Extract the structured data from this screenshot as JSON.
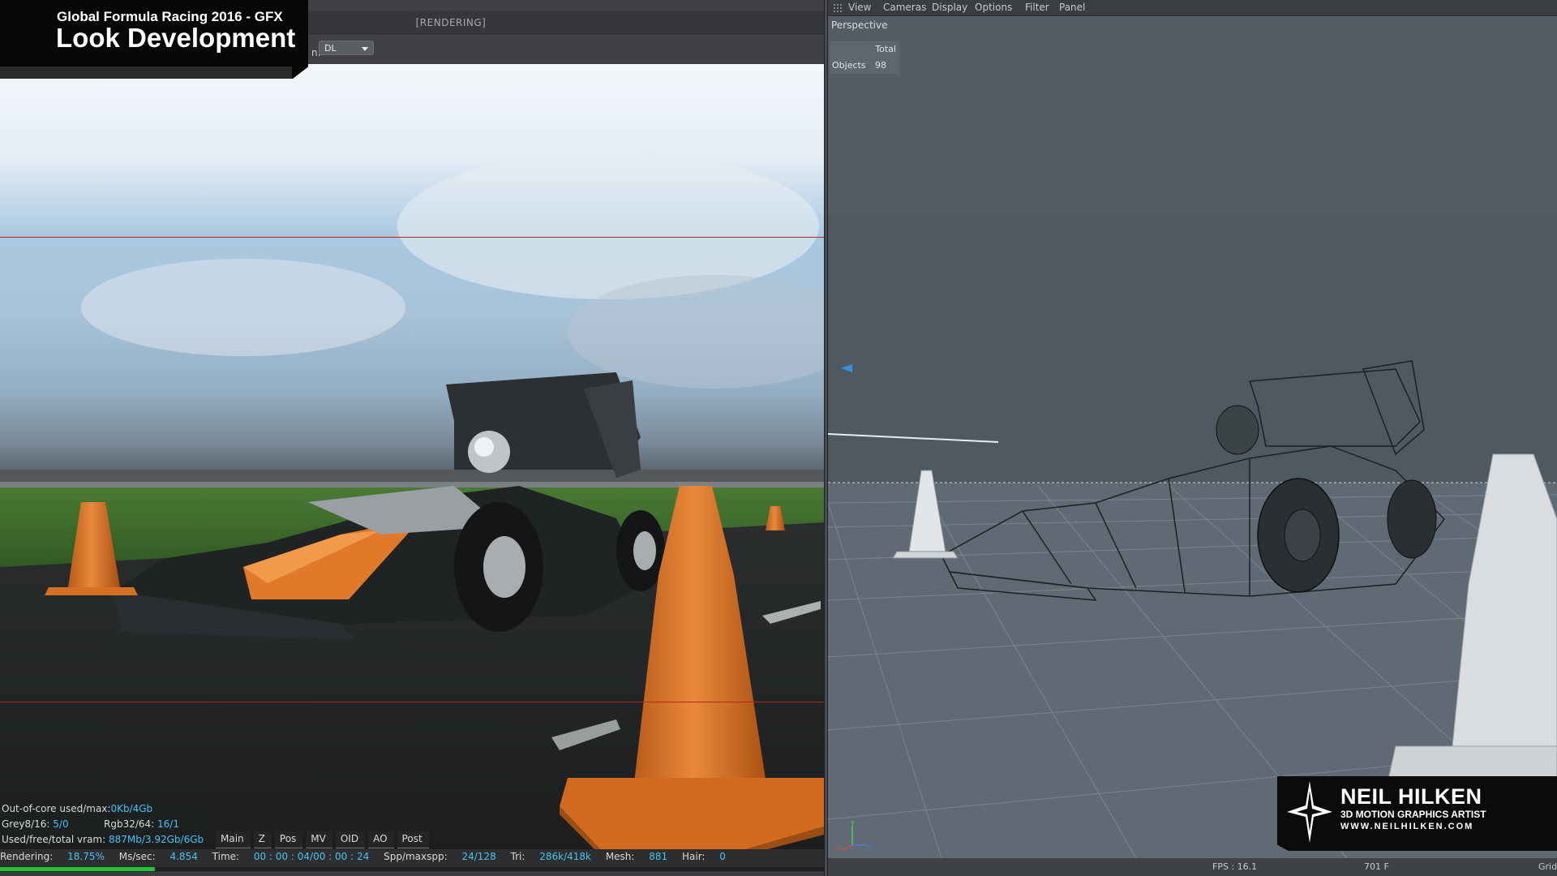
{
  "title_badge": {
    "subtitle": "Global Formula Racing 2016 - GFX",
    "title": "Look Development"
  },
  "render_window": {
    "status": "[RENDERING]",
    "kernel_label_fragment": "n:",
    "kernel_value": "DL",
    "stats": {
      "outofcore_label": "Out-of-core used/max:",
      "outofcore_value": "0Kb/4Gb",
      "grey_label": "Grey8/16: ",
      "grey_value": "5/0",
      "rgb_label": "Rgb32/64: ",
      "rgb_value": "16/1",
      "vram_label": "Used/free/total vram: ",
      "vram_value": "887Mb/3.92Gb/6Gb"
    },
    "passes": [
      "Main",
      "Z",
      "Pos",
      "MV",
      "OID",
      "AO",
      "Post"
    ],
    "status_bar": {
      "rendering_label": "Rendering: ",
      "rendering_value": "18.75%",
      "mssec_label": "Ms/sec: ",
      "mssec_value": "4.854",
      "time_label": "Time: ",
      "time_value": "00 : 00 : 04/00 : 00 : 24",
      "spp_label": "Spp/maxspp: ",
      "spp_value": "24/128",
      "tri_label": "Tri: ",
      "tri_value": "286k/418k",
      "mesh_label": "Mesh: ",
      "mesh_value": "881",
      "hair_label": "Hair: ",
      "hair_value": "0"
    },
    "progress_fraction": 0.1875
  },
  "viewport": {
    "menu": [
      "View",
      "Cameras",
      "Display",
      "Options",
      "Filter",
      "Panel"
    ],
    "camera": "Perspective",
    "stats_header": "Total",
    "stats_label": "Objects",
    "stats_value": "98",
    "fps": "FPS : 16.1",
    "frame": "701 F",
    "grid": "Grid"
  },
  "watermark": {
    "name": "NEIL HILKEN",
    "role": "3D MOTION GRAPHICS ARTIST",
    "url": "WWW.NEILHILKEN.COM"
  },
  "colors": {
    "accent_blue": "#46c2f0",
    "progress_green": "#22c436",
    "cone_orange": "#e07a2a"
  }
}
